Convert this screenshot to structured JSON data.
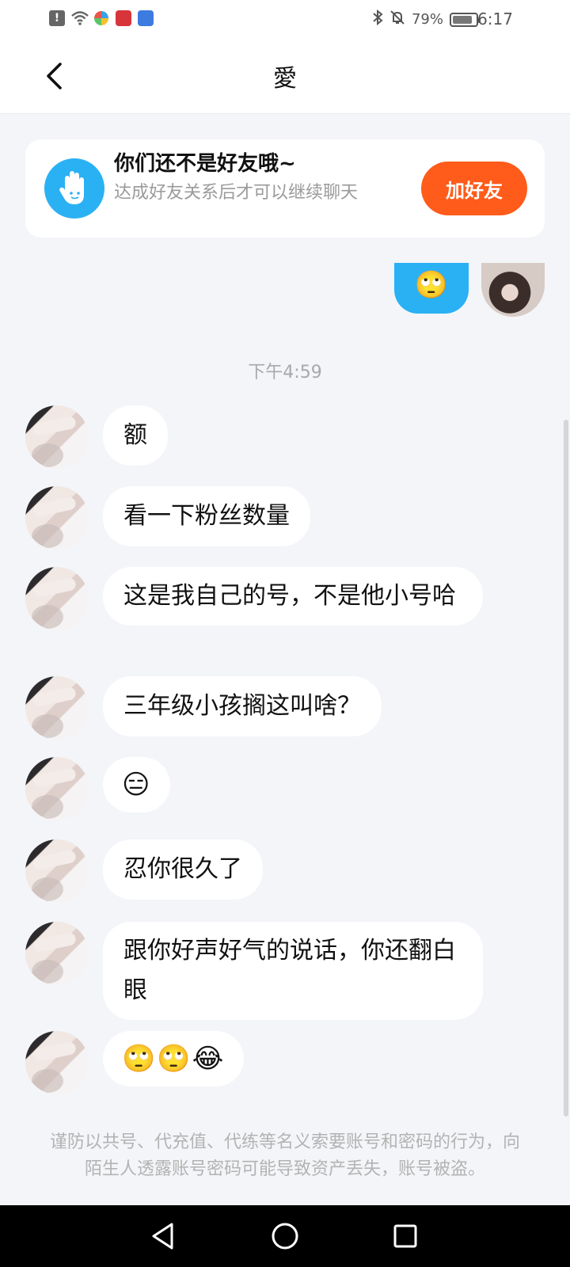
{
  "status_bar": {
    "battery_text": "79%",
    "battery_level": 0.79,
    "time": "6:17",
    "left_icons": [
      "alert-icon",
      "wifi-icon",
      "app-icon-pinwheel",
      "app-icon-red",
      "app-icon-blue"
    ],
    "right_icons": [
      "bluetooth-icon",
      "mute-icon",
      "battery-icon"
    ]
  },
  "header": {
    "title": "愛",
    "back_icon": "chevron-left-icon"
  },
  "friend_card": {
    "title": "你们还不是好友哦~",
    "subtitle": "达成好友关系后才可以继续聊天",
    "button_label": "加好友",
    "icon": "hand-wave-icon",
    "button_color": "#ff5b1a",
    "icon_color": "#2ab1f4"
  },
  "my_message": {
    "content": "🙄",
    "bubble_color": "#2ab1f4"
  },
  "time_divider": "下午4:59",
  "messages": [
    {
      "text": "额"
    },
    {
      "text": "看一下粉丝数量"
    },
    {
      "text": "这是我自己的号，不是他小号哈"
    },
    {
      "text": "三年级小孩搁这叫啥？"
    },
    {
      "text": "😑"
    },
    {
      "text": "忍你很久了"
    },
    {
      "text": "跟你好声好气的说话，你还翻白眼"
    },
    {
      "text": "🙄🙄😂"
    }
  ],
  "warning": "谨防以共号、代充值、代练等名义索要账号和密码的行为，向陌生人透露账号密码可能导致资产丢失，账号被盗。",
  "nav_bar": {
    "icons": [
      "back-triangle-icon",
      "home-circle-icon",
      "recents-square-icon"
    ]
  }
}
